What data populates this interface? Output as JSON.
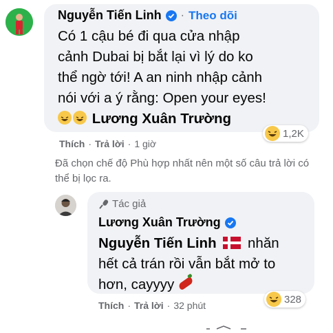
{
  "comment1": {
    "author": "Nguyễn Tiến Linh",
    "separator": "·",
    "follow_label": "Theo dõi",
    "lines": [
      "Có 1 cậu bé đi qua cửa nhập",
      "cảnh Dubai bị bắt lại vì lý do ko",
      "thể ngờ tới! A an ninh nhập cảnh",
      "nói với a ý rằng: Open your eyes!"
    ],
    "mention": "Lương Xuân Trường",
    "reaction_icon": "haha-emoji",
    "reaction_count": "1,2K",
    "actions": {
      "like": "Thích",
      "reply": "Trả lời",
      "time": "1 giờ",
      "sep": "·"
    }
  },
  "filter_note": "Đã chọn chế độ Phù hợp nhất nên một số câu trả lời có thể bị lọc ra.",
  "reply1": {
    "author_badge": "Tác giả",
    "author": "Lương Xuân Trường",
    "mention": "Nguyễn Tiến Linh",
    "text_after_mention": "nhăn",
    "lines": [
      "hết cả trán rồi vẫn bắt mở to",
      "hơn, cayyyy"
    ],
    "reaction_icon": "haha-emoji",
    "reaction_count": "328",
    "actions": {
      "like": "Thích",
      "reply": "Trả lời",
      "time": "32 phút",
      "sep": "·"
    }
  },
  "colors": {
    "link_blue": "#1877f2",
    "bubble_bg": "#f0f2f5",
    "meta_gray": "#65676b"
  }
}
